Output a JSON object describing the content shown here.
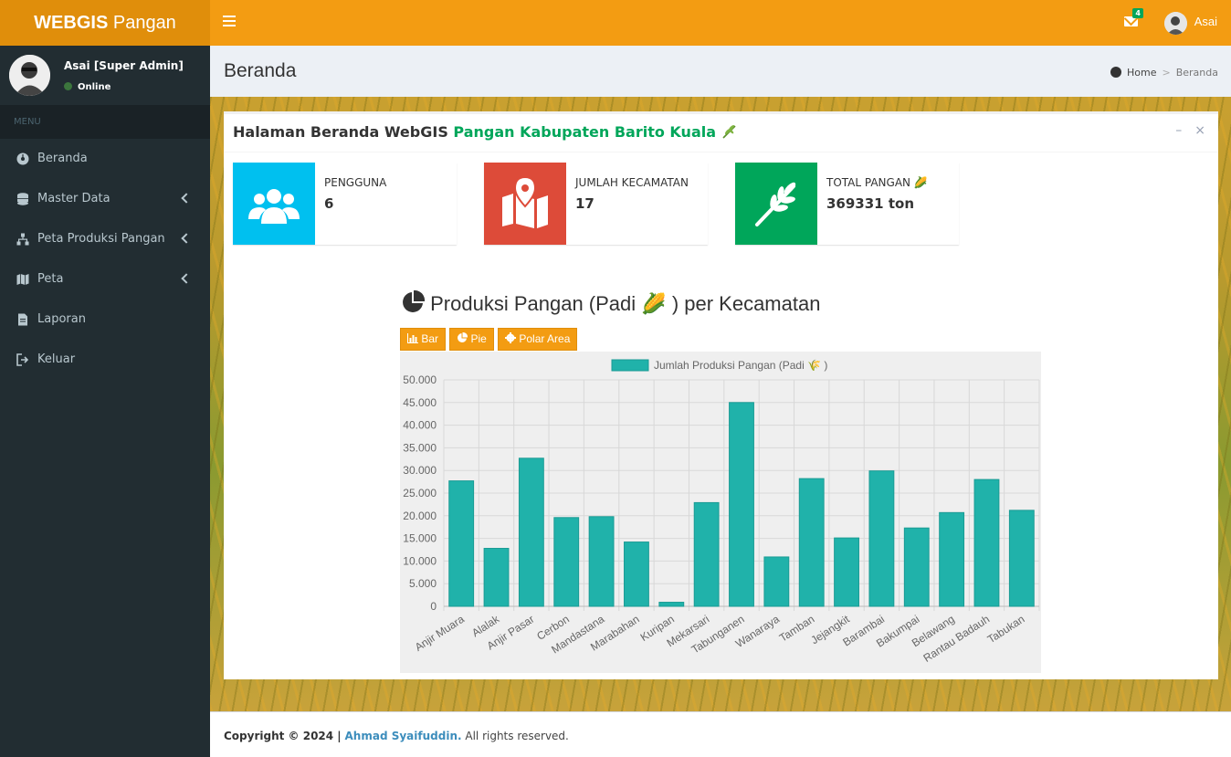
{
  "logo": {
    "bold": "WEBGIS",
    "rest": " Pangan"
  },
  "topbar": {
    "mail_count": "4",
    "user": "Asai"
  },
  "sidebar": {
    "user_name": "Asai [Super Admin]",
    "status": "Online",
    "menu_header": "MENU",
    "items": [
      {
        "label": "Beranda",
        "icon": "dashboard-icon"
      },
      {
        "label": "Master Data",
        "icon": "database-icon"
      },
      {
        "label": "Peta Produksi Pangan",
        "icon": "sitemap-icon"
      },
      {
        "label": "Peta",
        "icon": "map-icon"
      },
      {
        "label": "Laporan",
        "icon": "file-icon"
      },
      {
        "label": "Keluar",
        "icon": "sign-out-icon"
      }
    ]
  },
  "content": {
    "title": "Beranda",
    "breadcrumb": {
      "home": "Home",
      "current": "Beranda"
    }
  },
  "box": {
    "title_plain": "Halaman Beranda WebGIS ",
    "title_green": "Pangan Kabupaten Barito Kuala",
    "tools": {
      "minimize": "–",
      "close": "×"
    }
  },
  "stats": [
    {
      "label": "PENGGUNA",
      "value": "6",
      "color": "#00c0ef",
      "icon": "users-icon"
    },
    {
      "label": "JUMLAH KECAMATAN",
      "value": "17",
      "color": "#dd4b39",
      "icon": "map-marker-icon"
    },
    {
      "label": "TOTAL PANGAN",
      "value": "369331 ton",
      "color": "#00a65a",
      "icon": "wheat-icon"
    }
  ],
  "chart_section": {
    "heading_before": "Produksi Pangan (Padi",
    "heading_after": ") per Kecamatan",
    "buttons": {
      "bar": "Bar",
      "pie": "Pie",
      "polar": "Polar Area"
    }
  },
  "chart_data": {
    "type": "bar",
    "categories": [
      "Anjir Muara",
      "Alalak",
      "Anjir Pasar",
      "Cerbon",
      "Mandastana",
      "Marabahan",
      "Kuripan",
      "Mekarsari",
      "Tabunganen",
      "Wanaraya",
      "Tamban",
      "Jejangkit",
      "Barambai",
      "Bakumpai",
      "Belawang",
      "Rantau Badauh",
      "Tabukan"
    ],
    "series": [
      {
        "name": "Jumlah Produksi Pangan (Padi 🌾 )",
        "values": [
          27700,
          12800,
          32700,
          19600,
          19800,
          14200,
          900,
          22900,
          45000,
          10900,
          28200,
          15100,
          29900,
          17300,
          20700,
          28000,
          21200
        ],
        "color": "#20b2aa"
      }
    ],
    "ylim": [
      0,
      50000
    ],
    "yticks": [
      "0",
      "5.000",
      "10.000",
      "15.000",
      "20.000",
      "25.000",
      "30.000",
      "35.000",
      "40.000",
      "45.000",
      "50.000"
    ],
    "legend": "top",
    "grid": true
  },
  "footer": {
    "copyright": "Copyright © 2024 |",
    "author": "Ahmad Syaifuddin.",
    "rights": " All rights reserved."
  }
}
